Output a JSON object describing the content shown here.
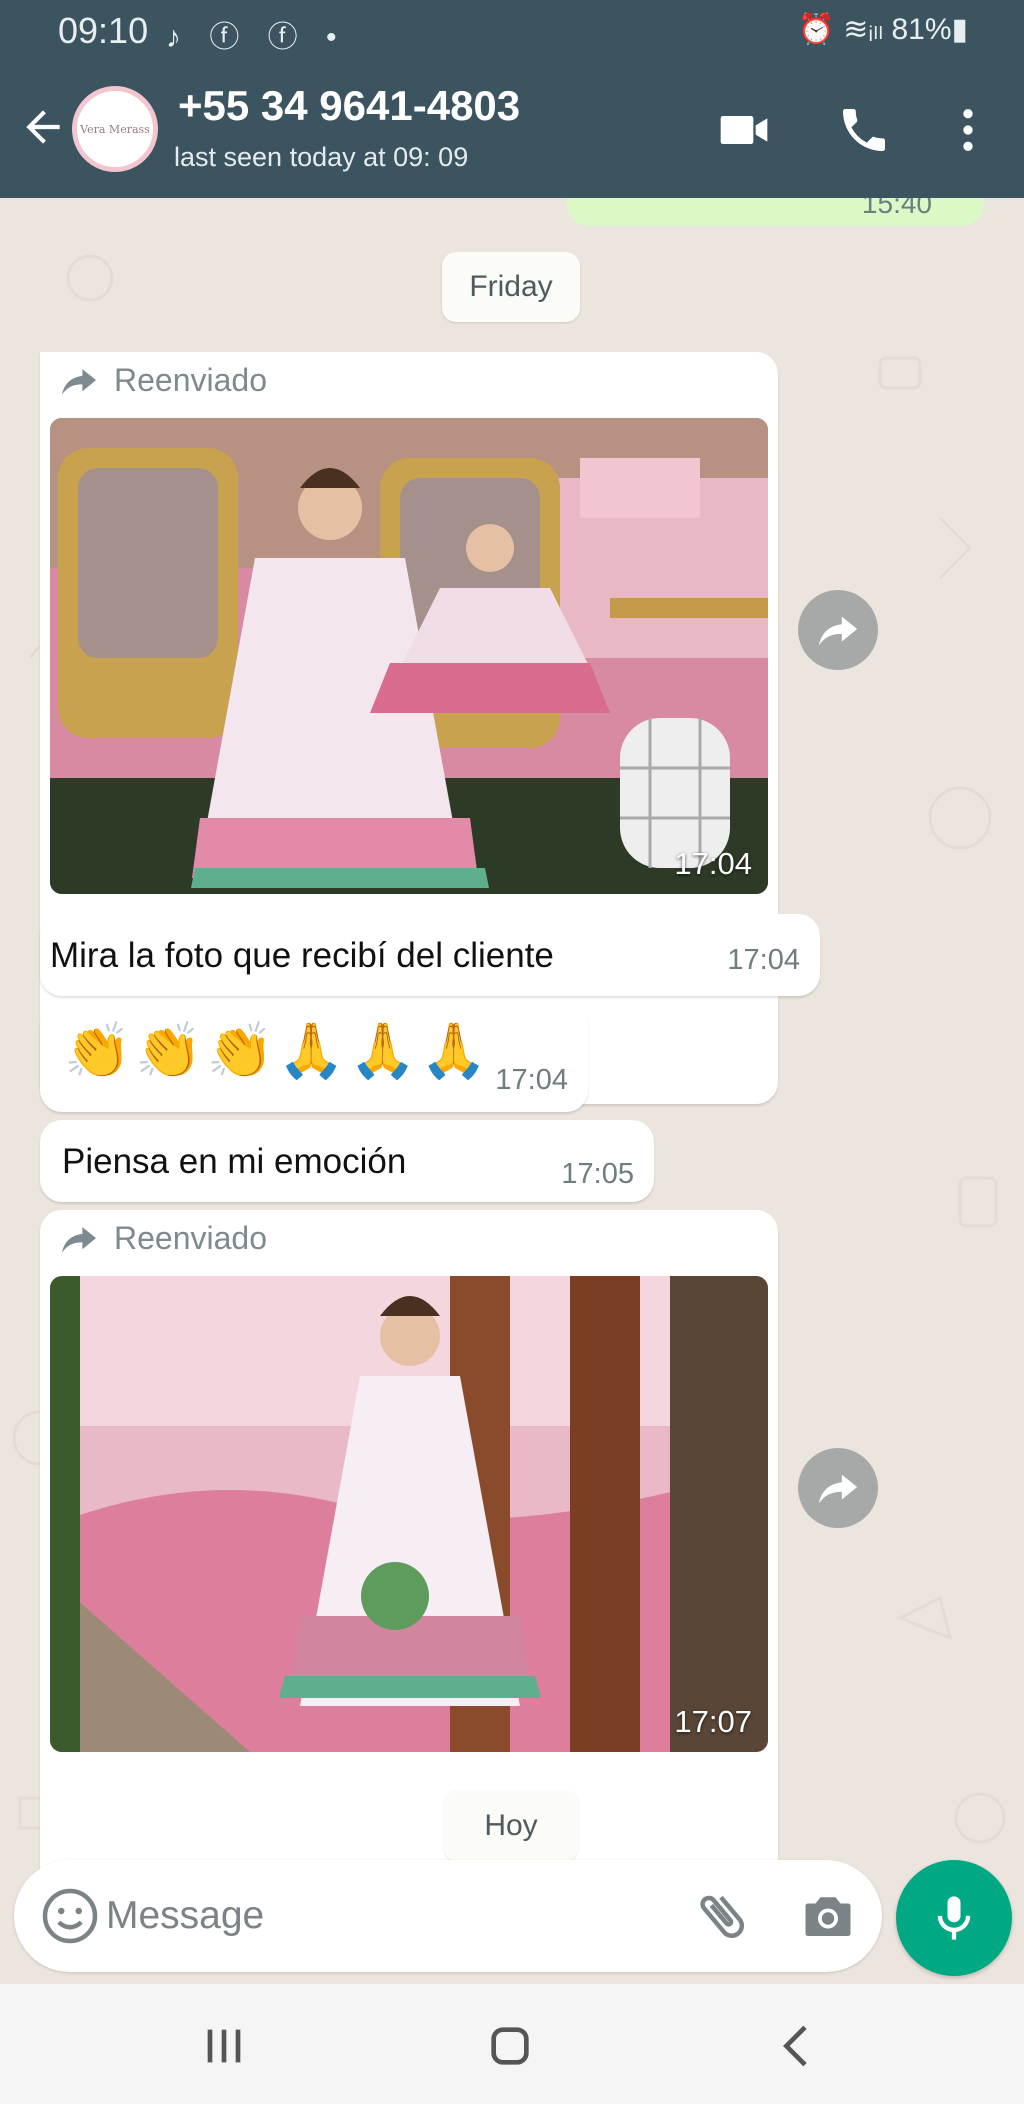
{
  "status_bar": {
    "time": "09:10",
    "app_icons": "♪ ⓕ ⓕ •",
    "right": "⏰ ≋ᵢₗₗ 81%▮"
  },
  "header": {
    "avatar_text": "Vera Merass",
    "contact_name": "+55 34 9641-4803",
    "last_seen": "last seen today at 09: 09",
    "icons": [
      "back-arrow-icon",
      "video-call-icon",
      "phone-icon",
      "more-vert-icon"
    ]
  },
  "chat": {
    "prev_sent_time": "15:40",
    "date_friday": "Friday",
    "messages": [
      {
        "type": "image",
        "forwarded_label": "Reenviado",
        "time": "17:04"
      },
      {
        "type": "text",
        "text": "Mira la foto que recibí del cliente",
        "time": "17:04"
      },
      {
        "type": "text",
        "text": "👏👏👏🙏🙏🙏",
        "time": "17:04"
      },
      {
        "type": "text",
        "text": "Piensa en mi emoción",
        "time": "17:05"
      },
      {
        "type": "image",
        "forwarded_label": "Reenviado",
        "time": "17:07"
      }
    ],
    "date_today": "Hoy"
  },
  "composer": {
    "placeholder": "Message",
    "icons": [
      "emoji-icon",
      "attach-icon",
      "camera-icon",
      "mic-icon"
    ]
  },
  "colors": {
    "header": "#3b5460",
    "chat_bg": "#ece5dd",
    "accent": "#00a884",
    "bubble": "#ffffff"
  }
}
